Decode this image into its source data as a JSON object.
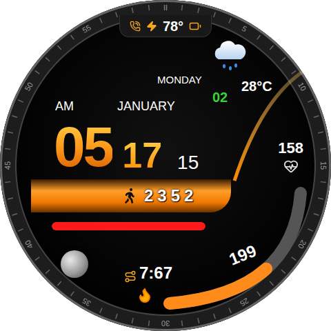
{
  "topBar": {
    "temperature": "78°"
  },
  "date": {
    "weekday": "MONDAY",
    "day": "02",
    "month": "JANUARY"
  },
  "temperature": "28°C",
  "time": {
    "period": "AM",
    "hours": "05",
    "minutes": "17",
    "seconds": "15"
  },
  "heartRate": "158",
  "steps": {
    "count": "2352",
    "level": 1
  },
  "calories": {
    "value": "199",
    "level": 0.55
  },
  "distance": "7:67",
  "bezel": [
    "II",
    "5",
    "10",
    "15",
    "20",
    "25",
    "30",
    "35",
    "40",
    "45",
    "50",
    "55"
  ]
}
